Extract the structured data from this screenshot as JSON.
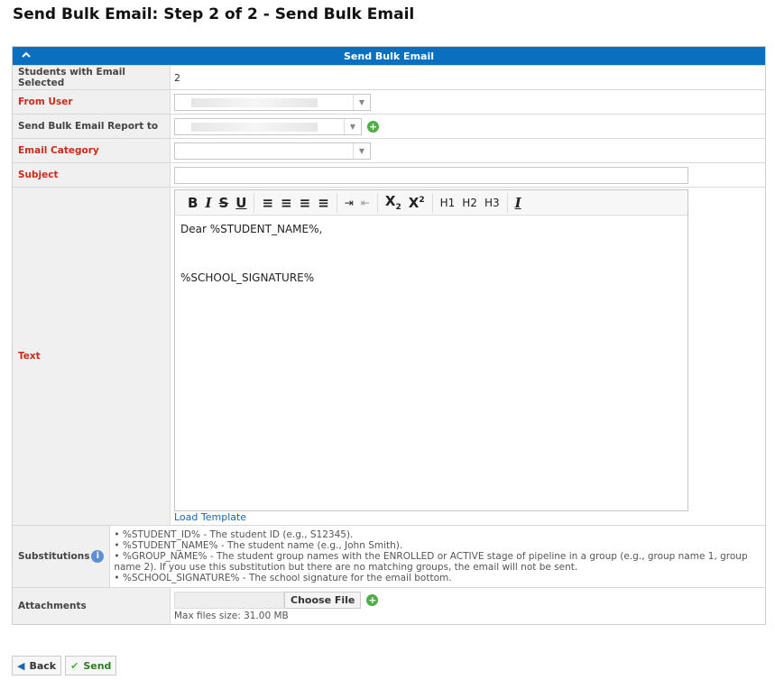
{
  "page": {
    "title": "Send Bulk Email: Step 2 of 2 - Send Bulk Email"
  },
  "panel": {
    "header": "Send Bulk Email"
  },
  "fields": {
    "students_label": "Students with Email Selected",
    "students_value": "2",
    "from_user_label": "From User",
    "report_to_label": "Send Bulk Email Report to",
    "category_label": "Email Category",
    "subject_label": "Subject",
    "text_label": "Text",
    "substitutions_label": "Substitutions",
    "attachments_label": "Attachments"
  },
  "editor": {
    "line1": "Dear %STUDENT_NAME%,",
    "line2": "%SCHOOL_SIGNATURE%",
    "load_template": "Load Template",
    "toolbar": {
      "h1": "H1",
      "h2": "H2",
      "h3": "H3"
    }
  },
  "substitutions": [
    "• %STUDENT_ID% - The student ID (e.g., S12345).",
    "• %STUDENT_NAME% - The student name (e.g., John Smith).",
    "• %GROUP_NAME% - The student group names with the ENROLLED or ACTIVE stage of pipeline in a group (e.g., group name 1, group name 2). If you use this substitution but there are no matching groups, the email will not be sent.",
    "• %SCHOOL_SIGNATURE% - The school signature for the email bottom."
  ],
  "attachments": {
    "choose_label": "Choose File",
    "max_size": "Max files size: 31.00 MB"
  },
  "actions": {
    "back": "Back",
    "send": "Send"
  },
  "colors": {
    "header": "#0b6fbf",
    "required": "#cc2a1a",
    "plus": "#4fae45"
  }
}
